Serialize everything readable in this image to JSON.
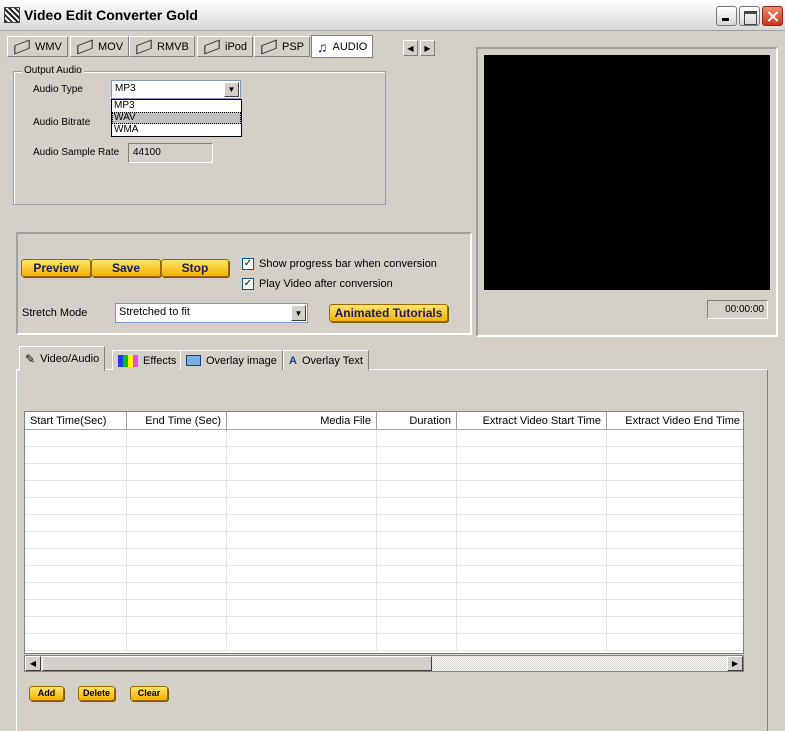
{
  "window": {
    "title": "Video Edit Converter Gold"
  },
  "format_tabs": [
    {
      "label": "WMV"
    },
    {
      "label": "MOV"
    },
    {
      "label": "RMVB"
    },
    {
      "label": "iPod"
    },
    {
      "label": "PSP"
    },
    {
      "label": "AUDIO"
    }
  ],
  "output_audio": {
    "legend": "Output Audio",
    "audio_type_label": "Audio Type",
    "audio_type_value": "MP3",
    "audio_type_options": [
      "MP3",
      "WAV",
      "WMA"
    ],
    "audio_bitrate_label": "Audio Bitrate",
    "sample_rate_label": "Audio Sample Rate",
    "sample_rate_value": "44100"
  },
  "controls": {
    "preview_label": "Preview",
    "save_label": "Save",
    "stop_label": "Stop",
    "show_progress_label": "Show progress bar when conversion",
    "show_progress_checked": true,
    "play_video_label": "Play Video after conversion",
    "play_video_checked": true,
    "stretch_mode_label": "Stretch Mode",
    "stretch_mode_value": "Stretched to fit",
    "tutorials_label": "Animated Tutorials"
  },
  "preview": {
    "timecode": "00:00:00"
  },
  "bottom_tabs": [
    {
      "label": "Video/Audio"
    },
    {
      "label": "Effects"
    },
    {
      "label": "Overlay image"
    },
    {
      "label": "Overlay Text"
    }
  ],
  "table": {
    "columns": [
      "Start Time(Sec)",
      "End Time (Sec)",
      "Media File",
      "Duration",
      "Extract Video Start Time",
      "Extract Video End Time"
    ]
  },
  "actions": {
    "add_label": "Add",
    "delete_label": "Delete",
    "clear_label": "Clear"
  }
}
